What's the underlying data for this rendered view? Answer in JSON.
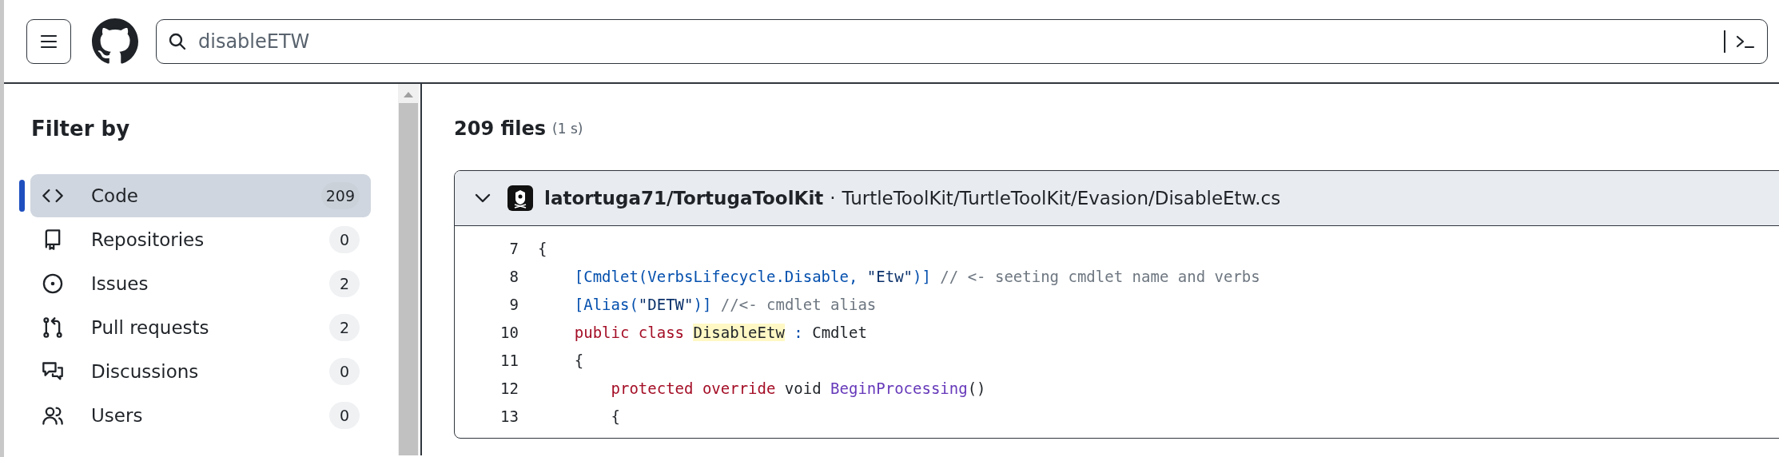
{
  "search": {
    "value": "disableETW"
  },
  "sidebar": {
    "title": "Filter by",
    "items": [
      {
        "label": "Code",
        "count": "209",
        "selected": true,
        "kind": "code"
      },
      {
        "label": "Repositories",
        "count": "0",
        "selected": false,
        "kind": "repo"
      },
      {
        "label": "Issues",
        "count": "2",
        "selected": false,
        "kind": "issue"
      },
      {
        "label": "Pull requests",
        "count": "2",
        "selected": false,
        "kind": "pull"
      },
      {
        "label": "Discussions",
        "count": "0",
        "selected": false,
        "kind": "discussion"
      },
      {
        "label": "Users",
        "count": "0",
        "selected": false,
        "kind": "users"
      }
    ]
  },
  "results": {
    "count": "209 files",
    "time": "(1 s)"
  },
  "result": {
    "expanded": true,
    "repo": "latortuga71/TortugaToolKit",
    "separator": "·",
    "path": "TurtleToolKit/TurtleToolKit/Evasion/DisableEtw.cs",
    "lines": [
      {
        "number": "7",
        "tokens": [
          {
            "text": "{",
            "kind": "plain"
          }
        ]
      },
      {
        "number": "8",
        "tokens": [
          {
            "text": "    [Cmdlet(VerbsLifecycle.Disable, ",
            "kind": "entity"
          },
          {
            "text": "\"Etw\"",
            "kind": "string"
          },
          {
            "text": ")]",
            "kind": "entity"
          },
          {
            "text": " // <- seeting cmdlet name and verbs",
            "kind": "comment"
          }
        ]
      },
      {
        "number": "9",
        "tokens": [
          {
            "text": "    [Alias(",
            "kind": "entity"
          },
          {
            "text": "\"DETW\"",
            "kind": "string"
          },
          {
            "text": ")]",
            "kind": "entity"
          },
          {
            "text": " //<- cmdlet alias",
            "kind": "comment"
          }
        ]
      },
      {
        "number": "10",
        "tokens": [
          {
            "text": "    public class ",
            "kind": "keyword"
          },
          {
            "text": "DisableEtw",
            "kind": "match"
          },
          {
            "text": " : ",
            "kind": "entity"
          },
          {
            "text": "Cmdlet",
            "kind": "plain"
          }
        ]
      },
      {
        "number": "11",
        "tokens": [
          {
            "text": "    {",
            "kind": "plain"
          }
        ]
      },
      {
        "number": "12",
        "tokens": [
          {
            "text": "        protected override ",
            "kind": "keyword"
          },
          {
            "text": "void ",
            "kind": "plain"
          },
          {
            "text": "BeginProcessing",
            "kind": "function"
          },
          {
            "text": "()",
            "kind": "plain"
          }
        ]
      },
      {
        "number": "13",
        "tokens": [
          {
            "text": "        {",
            "kind": "plain"
          }
        ]
      }
    ]
  }
}
